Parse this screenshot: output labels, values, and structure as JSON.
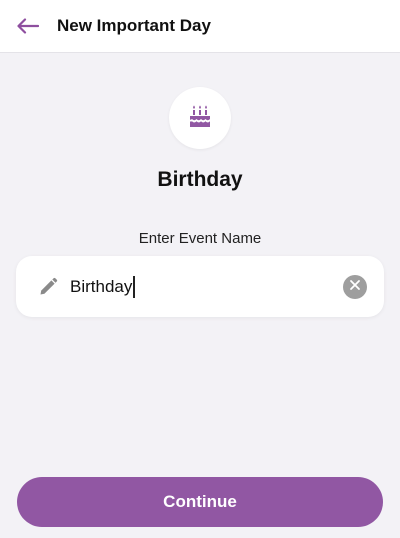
{
  "header": {
    "title": "New Important Day",
    "back_icon": "arrow-left-icon"
  },
  "event": {
    "icon": "birthday-cake-icon",
    "title": "Birthday"
  },
  "form": {
    "label": "Enter Event Name",
    "value": "Birthday",
    "leading_icon": "pencil-icon",
    "clear_icon": "clear-icon"
  },
  "footer": {
    "continue_label": "Continue"
  },
  "colors": {
    "accent": "#9157a3",
    "background": "#f3f2f6",
    "surface": "#ffffff",
    "clear_button": "#9e9e9e"
  }
}
